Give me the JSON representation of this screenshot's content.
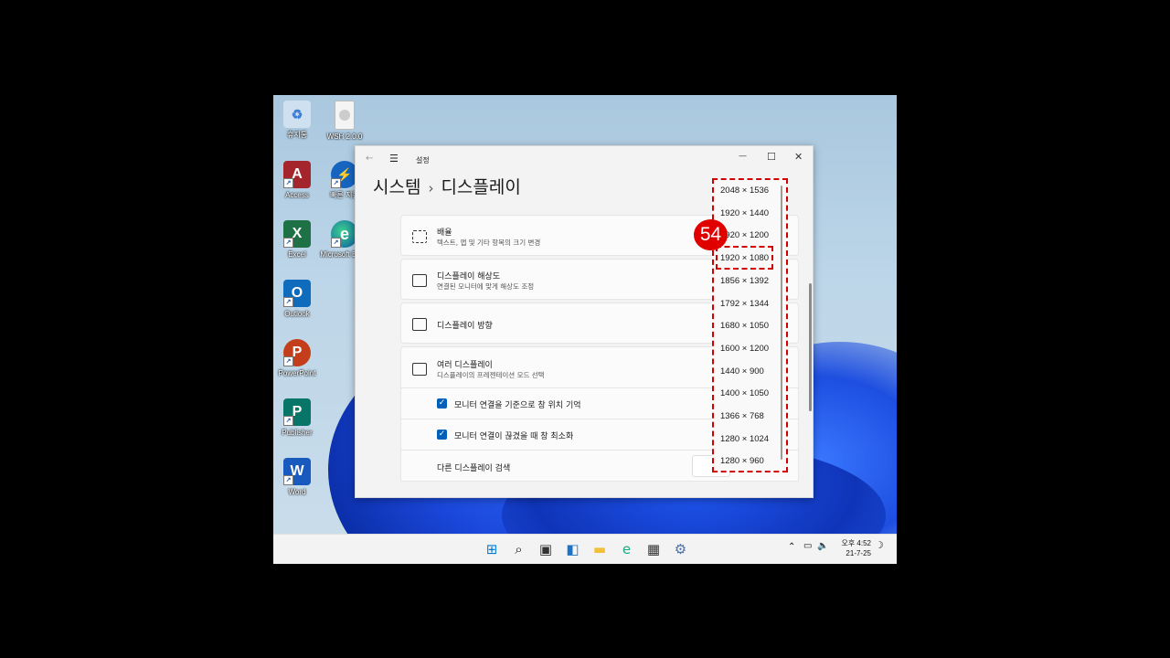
{
  "desktop": {
    "icons": [
      {
        "label": "휴지통",
        "icon": "recycle-bin-icon",
        "color": "#8ab0d8"
      },
      {
        "label": "WSH 2.0.0",
        "icon": "file-icon",
        "color": "#e8e8e8"
      },
      {
        "label": "Access",
        "icon": "access-icon",
        "color": "#a4262c",
        "letter": "A"
      },
      {
        "label": "빠른 지원",
        "icon": "quick-assist-icon",
        "color": "#1565c0",
        "letter": "⚡"
      },
      {
        "label": "Excel",
        "icon": "excel-icon",
        "color": "#1e7145",
        "letter": "X"
      },
      {
        "label": "Microsoft Edge",
        "icon": "edge-icon",
        "color": "#1faa8a",
        "letter": "e"
      },
      {
        "label": "Outlook",
        "icon": "outlook-icon",
        "color": "#0f6cbd",
        "letter": "O"
      },
      {
        "label": "PowerPoint",
        "icon": "powerpoint-icon",
        "color": "#c43e1c",
        "letter": "P"
      },
      {
        "label": "Publisher",
        "icon": "publisher-icon",
        "color": "#077568",
        "letter": "P"
      },
      {
        "label": "Word",
        "icon": "word-icon",
        "color": "#185abd",
        "letter": "W"
      }
    ]
  },
  "window": {
    "title": "설정",
    "back": "←",
    "menu": "☰",
    "minimize": "—",
    "maximize": "☐",
    "close": "✕"
  },
  "breadcrumb": {
    "parent": "시스템",
    "separator": "›",
    "current": "디스플레이"
  },
  "settings": {
    "scale": {
      "title": "배율",
      "subtitle": "텍스트, 앱 및 기타 항목의 크기 변경"
    },
    "resolution": {
      "title": "디스플레이 해상도",
      "subtitle": "연결된 모니터에 맞게 해상도 조정"
    },
    "orientation": {
      "title": "디스플레이 방향"
    },
    "multiple": {
      "title": "여러 디스플레이",
      "subtitle": "디스플레이의 프레젠테이션 모드 선택"
    },
    "remember": "모니터 연결을 기준으로 창 위치 기억",
    "minimize": "모니터 연결이 끊겼을 때 창 최소화",
    "detect": "다른 디스플레이 검색"
  },
  "resolution_options": [
    "2048 × 1536",
    "1920 × 1440",
    "1920 × 1200",
    "1920 × 1080",
    "1856 × 1392",
    "1792 × 1344",
    "1680 × 1050",
    "1600 × 1200",
    "1440 × 900",
    "1400 × 1050",
    "1366 × 768",
    "1280 × 1024",
    "1280 × 960"
  ],
  "selected_resolution": "1920 × 1080",
  "step_badge": "54",
  "taskbar": {
    "apps": [
      {
        "icon": "start-icon",
        "color": "#0078d4"
      },
      {
        "icon": "search-icon",
        "color": "#222222"
      },
      {
        "icon": "task-view-icon",
        "color": "#333333"
      },
      {
        "icon": "widgets-icon",
        "color": "#1a73c8"
      },
      {
        "icon": "file-explorer-icon",
        "color": "#f2c037"
      },
      {
        "icon": "edge-icon",
        "color": "#1faa8a"
      },
      {
        "icon": "store-icon",
        "color": "#333333"
      },
      {
        "icon": "settings-gear-icon",
        "color": "#4a6fa5"
      }
    ],
    "time": "오후 4:52",
    "date": "21-7-25"
  }
}
